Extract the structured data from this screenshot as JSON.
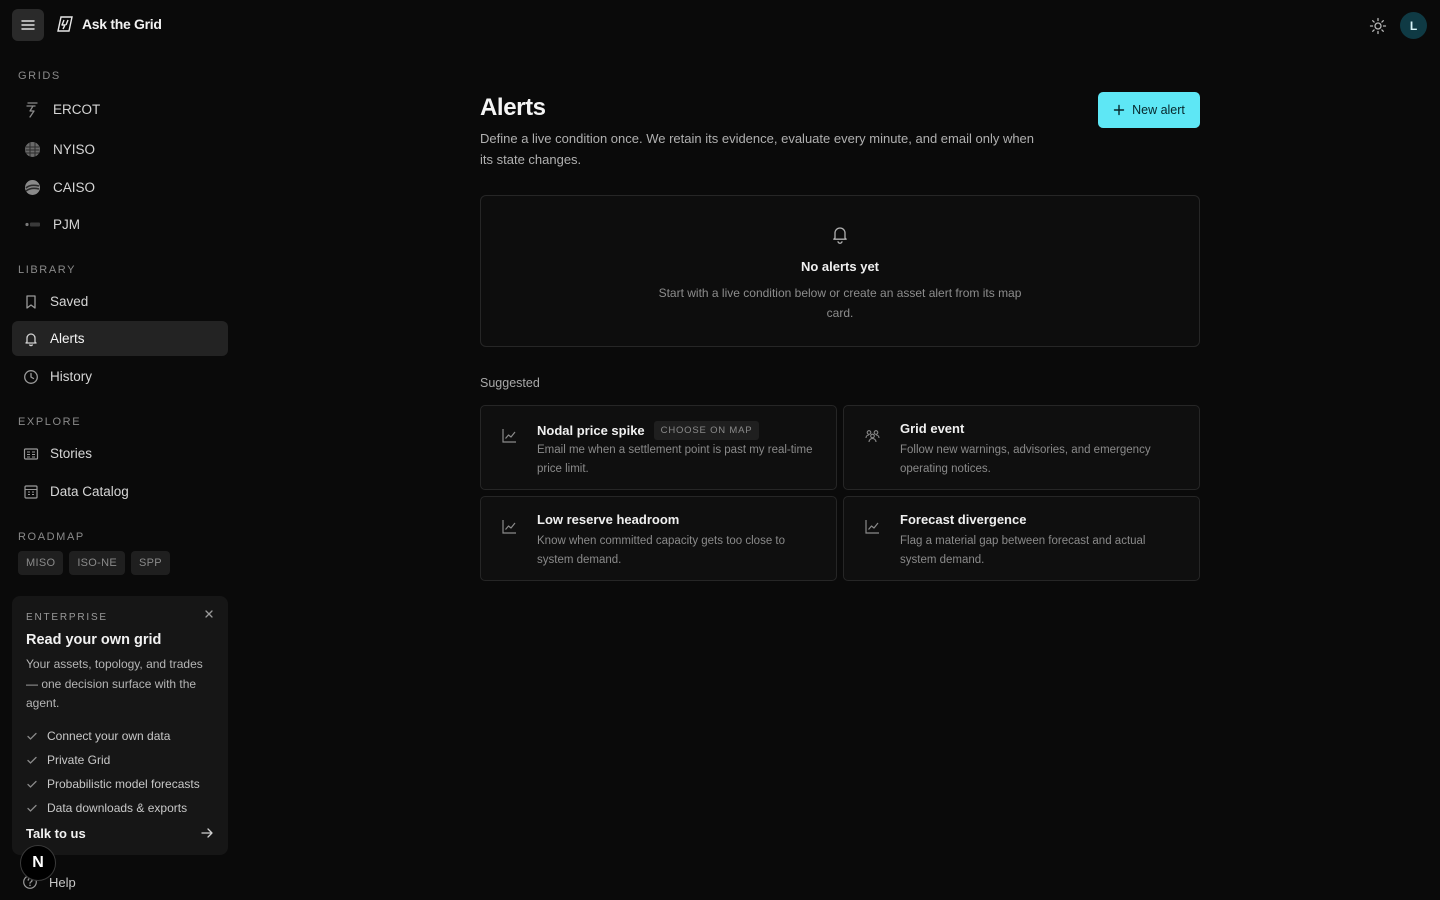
{
  "header": {
    "brand_name": "Ask the Grid",
    "avatar_initial": "L"
  },
  "sidebar": {
    "sections": {
      "grids": "GRIDS",
      "library": "LIBRARY",
      "explore": "EXPLORE",
      "roadmap": "ROADMAP"
    },
    "grids": [
      {
        "label": "ERCOT",
        "icon": "ercot-logo-icon"
      },
      {
        "label": "NYISO",
        "icon": "nyiso-logo-icon"
      },
      {
        "label": "CAISO",
        "icon": "caiso-logo-icon"
      },
      {
        "label": "PJM",
        "icon": "pjm-logo-icon"
      }
    ],
    "library": [
      {
        "label": "Saved",
        "icon": "bookmark-icon"
      },
      {
        "label": "Alerts",
        "icon": "bell-icon",
        "active": true
      },
      {
        "label": "History",
        "icon": "clock-icon"
      }
    ],
    "explore": [
      {
        "label": "Stories",
        "icon": "newspaper-icon"
      },
      {
        "label": "Data Catalog",
        "icon": "catalog-icon"
      }
    ],
    "roadmap": [
      "MISO",
      "ISO-NE",
      "SPP"
    ],
    "enterprise": {
      "label": "ENTERPRISE",
      "title": "Read your own grid",
      "description": "Your assets, topology, and trades — one decision surface with the agent.",
      "features": [
        "Connect your own data",
        "Private Grid",
        "Probabilistic model forecasts",
        "Data downloads & exports"
      ],
      "cta": "Talk to us"
    },
    "help": "Help",
    "n_badge": "N"
  },
  "main": {
    "title": "Alerts",
    "description": "Define a live condition once. We retain its evidence, evaluate every minute, and email only when its state changes.",
    "new_alert_label": "New alert",
    "empty": {
      "title": "No alerts yet",
      "description": "Start with a live condition below or create an asset alert from its map card."
    },
    "suggested_label": "Suggested",
    "suggestions": [
      {
        "title": "Nodal price spike",
        "badge": "CHOOSE ON MAP",
        "description": "Email me when a settlement point is past my real-time price limit.",
        "icon": "chart-line-icon"
      },
      {
        "title": "Grid event",
        "description": "Follow new warnings, advisories, and emergency operating notices.",
        "icon": "users-icon"
      },
      {
        "title": "Low reserve headroom",
        "description": "Know when committed capacity gets too close to system demand.",
        "icon": "chart-line-icon"
      },
      {
        "title": "Forecast divergence",
        "description": "Flag a material gap between forecast and actual system demand.",
        "icon": "chart-line-icon"
      }
    ]
  },
  "colors": {
    "background": "#0a0a0a",
    "accent": "#5ee7f5",
    "active_nav": "#232323",
    "avatar_bg": "#0f3a44"
  }
}
